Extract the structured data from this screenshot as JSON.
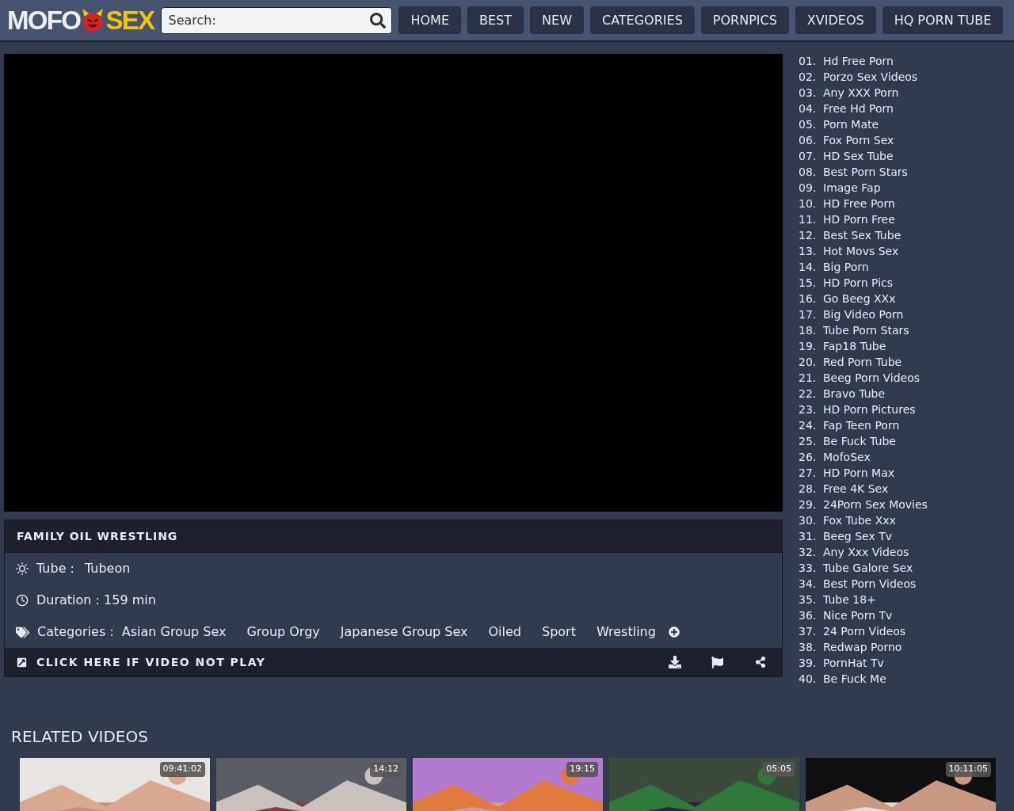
{
  "header": {
    "logo": {
      "left": "MOFO",
      "right": "SEX"
    },
    "search": {
      "placeholder": "Search:"
    },
    "nav": [
      {
        "label": "HOME"
      },
      {
        "label": "BEST"
      },
      {
        "label": "NEW"
      },
      {
        "label": "CATEGORIES"
      },
      {
        "label": "PORNPICS"
      },
      {
        "label": "XVIDEOS"
      },
      {
        "label": "HQ PORN TUBE"
      }
    ]
  },
  "video": {
    "title": "FAMILY OIL WRESTLING",
    "tube_label": "Tube :",
    "tube": "Tubeon",
    "duration": "Duration : 159 min",
    "categories_label": "Categories :",
    "categories": [
      "Asian Group Sex",
      "Group Orgy",
      "Japanese Group Sex",
      "Oiled",
      "Sport",
      "Wrestling"
    ],
    "not_play": "CLICK HERE IF VIDEO NOT PLAY"
  },
  "sidebar": [
    {
      "num": "01.",
      "label": "Hd Free Porn"
    },
    {
      "num": "02.",
      "label": "Porzo Sex Videos"
    },
    {
      "num": "03.",
      "label": "Any XXX Porn"
    },
    {
      "num": "04.",
      "label": "Free Hd Porn"
    },
    {
      "num": "05.",
      "label": "Porn Mate"
    },
    {
      "num": "06.",
      "label": "Fox Porn Sex"
    },
    {
      "num": "07.",
      "label": "HD Sex Tube"
    },
    {
      "num": "08.",
      "label": "Best Porn Stars"
    },
    {
      "num": "09.",
      "label": "Image Fap"
    },
    {
      "num": "10.",
      "label": "HD Free Porn"
    },
    {
      "num": "11.",
      "label": "HD Porn Free"
    },
    {
      "num": "12.",
      "label": "Best Sex Tube"
    },
    {
      "num": "13.",
      "label": "Hot Movs Sex"
    },
    {
      "num": "14.",
      "label": "Big Porn"
    },
    {
      "num": "15.",
      "label": "HD Porn Pics"
    },
    {
      "num": "16.",
      "label": "Go Beeg XXx"
    },
    {
      "num": "17.",
      "label": "Big Video Porn"
    },
    {
      "num": "18.",
      "label": "Tube Porn Stars"
    },
    {
      "num": "19.",
      "label": "Fap18 Tube"
    },
    {
      "num": "20.",
      "label": "Red Porn Tube"
    },
    {
      "num": "21.",
      "label": "Beeg Porn Videos"
    },
    {
      "num": "22.",
      "label": "Bravo Tube"
    },
    {
      "num": "23.",
      "label": "HD Porn Pictures"
    },
    {
      "num": "24.",
      "label": "Fap Teen Porn"
    },
    {
      "num": "25.",
      "label": "Be Fuck Tube"
    },
    {
      "num": "26.",
      "label": "MofoSex"
    },
    {
      "num": "27.",
      "label": "HD Porn Max"
    },
    {
      "num": "28.",
      "label": "Free 4K Sex"
    },
    {
      "num": "29.",
      "label": "24Porn Sex Movies"
    },
    {
      "num": "30.",
      "label": "Fox Tube Xxx"
    },
    {
      "num": "31.",
      "label": "Beeg Sex Tv"
    },
    {
      "num": "32.",
      "label": "Any Xxx Videos"
    },
    {
      "num": "33.",
      "label": "Tube Galore Sex"
    },
    {
      "num": "34.",
      "label": "Best Porn Videos"
    },
    {
      "num": "35.",
      "label": "Tube 18+"
    },
    {
      "num": "36.",
      "label": "Nice Porn Tv"
    },
    {
      "num": "37.",
      "label": "24 Porn Videos"
    },
    {
      "num": "38.",
      "label": "Redwap Porno"
    },
    {
      "num": "39.",
      "label": "PornHat Tv"
    },
    {
      "num": "40.",
      "label": "Be Fuck Me"
    }
  ],
  "related": {
    "title": "RELATED VIDEOS",
    "items": [
      {
        "kind": "picture",
        "duration": "09:41:02"
      },
      {
        "kind": "picture",
        "duration": "14:12"
      },
      {
        "kind": "picture",
        "duration": "19:15"
      },
      {
        "kind": "picture",
        "duration": "05:05"
      },
      {
        "kind": "picture",
        "duration": "10:11:05"
      }
    ]
  }
}
